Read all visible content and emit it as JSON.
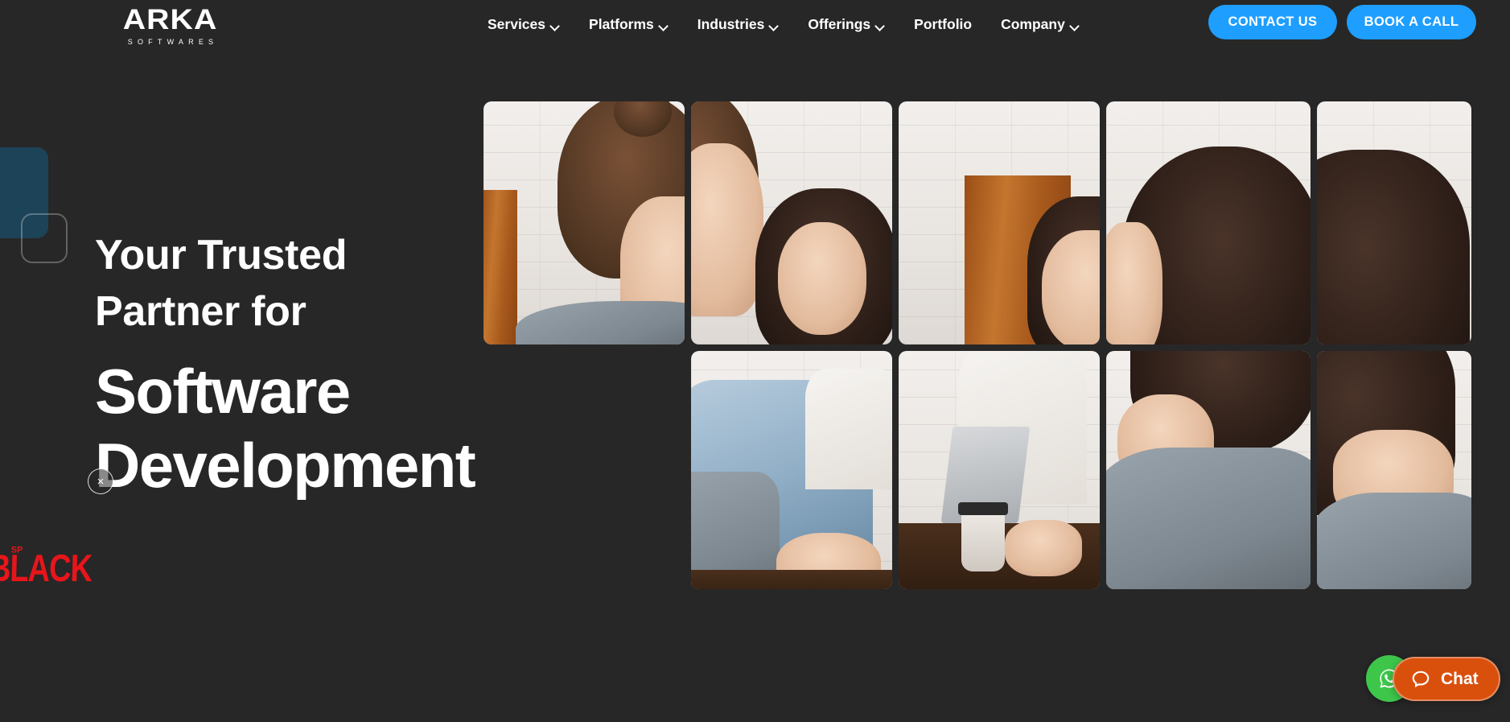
{
  "brand": {
    "name": "ARKA",
    "tagline": "SOFTWARES"
  },
  "nav": {
    "items": [
      {
        "label": "Services",
        "has_dropdown": true
      },
      {
        "label": "Platforms",
        "has_dropdown": true
      },
      {
        "label": "Industries",
        "has_dropdown": true
      },
      {
        "label": "Offerings",
        "has_dropdown": true
      },
      {
        "label": "Portfolio",
        "has_dropdown": false
      },
      {
        "label": "Company",
        "has_dropdown": true
      }
    ]
  },
  "cta": {
    "contact_label": "CONTACT US",
    "book_label": "BOOK A CALL",
    "accent_color": "#1E9EFF"
  },
  "hero": {
    "line1": "Your Trusted",
    "line2": "Partner for",
    "line3": "Software",
    "line4": "Development"
  },
  "promo": {
    "logo_text": "BLACK",
    "superscript": "SP",
    "close_label": "×",
    "color": "#e8151b"
  },
  "widgets": {
    "whatsapp_label": "whatsapp-icon",
    "chat_label": "Chat",
    "chat_color": "#d9500d",
    "whatsapp_color": "#3ec64b"
  },
  "theme": {
    "background": "#272727",
    "text": "#ffffff",
    "deco_fill": "#1d4358"
  }
}
